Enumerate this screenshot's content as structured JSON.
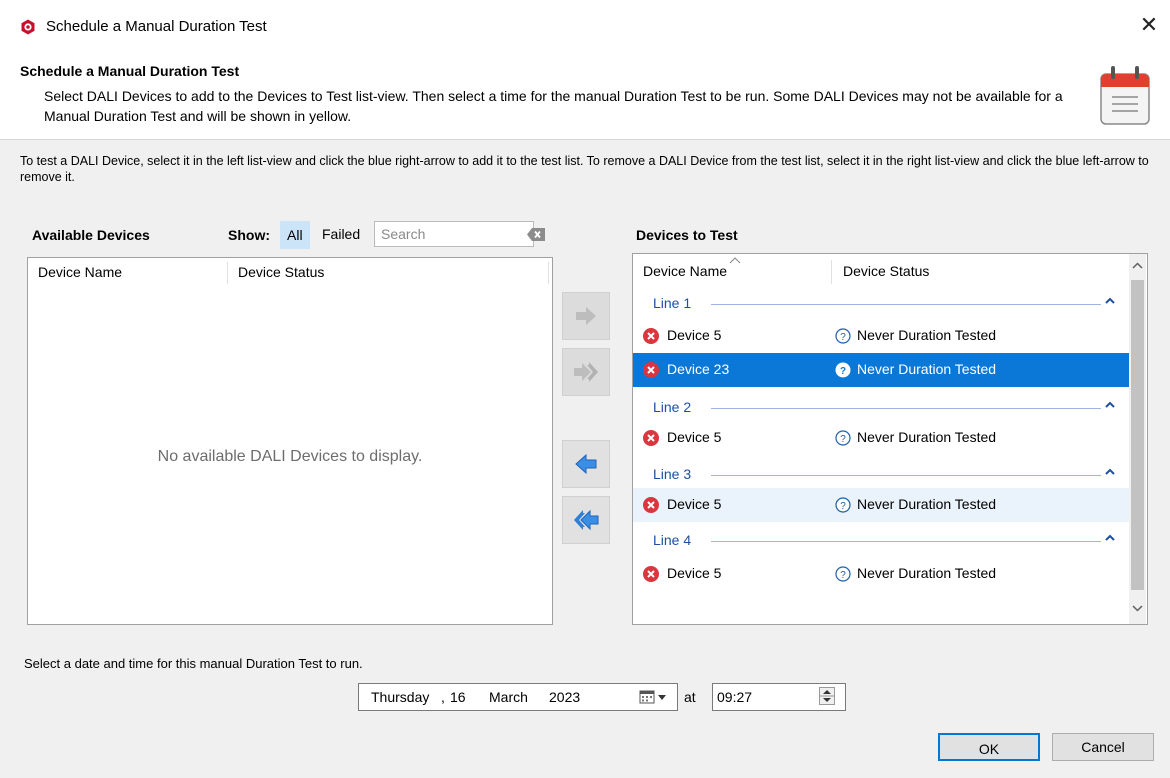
{
  "window": {
    "title": "Schedule a Manual Duration Test",
    "close_glyph": "✕"
  },
  "header": {
    "title": "Schedule a Manual Duration Test",
    "description": "Select DALI Devices to add to the Devices to Test list-view.  Then select a time for the manual Duration Test to be run.  Some DALI Devices may not be available for a Manual Duration Test and will be shown in yellow.",
    "icon": "calendar-icon"
  },
  "instructions": "To test a DALI Device, select it in the left list-view and click the blue right-arrow to add it to the test list.  To remove a DALI Device from the test list, select it in the right list-view and click the blue left-arrow to remove it.",
  "available": {
    "title": "Available Devices",
    "show_label": "Show:",
    "filters": {
      "all": "All",
      "failed": "Failed"
    },
    "search_placeholder": "Search",
    "columns": {
      "name": "Device Name",
      "status": "Device Status"
    },
    "empty_message": "No available DALI Devices to display."
  },
  "test": {
    "title": "Devices to Test",
    "columns": {
      "name": "Device Name",
      "status": "Device Status"
    },
    "groups": [
      {
        "label": "Line 1",
        "rows": [
          {
            "name": "Device 5",
            "status": "Never Duration Tested"
          },
          {
            "name": "Device 23",
            "status": "Never Duration Tested"
          }
        ]
      },
      {
        "label": "Line 2",
        "rows": [
          {
            "name": "Device 5",
            "status": "Never Duration Tested"
          }
        ]
      },
      {
        "label": "Line 3",
        "rows": [
          {
            "name": "Device 5",
            "status": "Never Duration Tested"
          }
        ]
      },
      {
        "label": "Line 4",
        "rows": [
          {
            "name": "Device 5",
            "status": "Never Duration Tested"
          }
        ]
      }
    ]
  },
  "schedule": {
    "label": "Select a date and time for this manual Duration Test to run.",
    "date": {
      "weekday": "Thursday",
      "sep": ",",
      "day": "16",
      "month": "March",
      "year": "2023"
    },
    "at_label": "at",
    "time": "09:27"
  },
  "buttons": {
    "ok": "OK",
    "cancel": "Cancel"
  },
  "colors": {
    "accent": "#0078d7",
    "selected_row": "#0b78d7",
    "group_text": "#1f4fa3",
    "error": "#d9363e"
  }
}
